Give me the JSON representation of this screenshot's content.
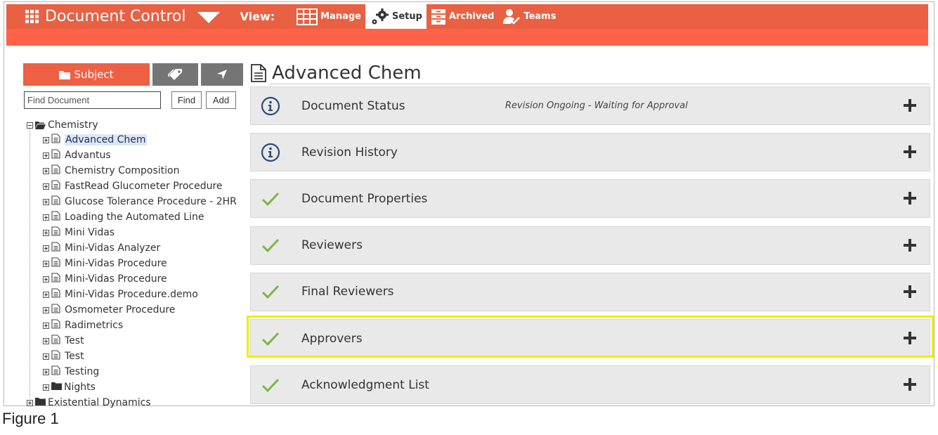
{
  "header": {
    "app_title": "Document Control",
    "view_label": "View:",
    "views": [
      {
        "label": "Manage"
      },
      {
        "label": "Setup"
      },
      {
        "label": "Archived"
      },
      {
        "label": "Teams"
      }
    ]
  },
  "sidebar": {
    "tab_subject": "Subject",
    "search_placeholder": "Find Document",
    "find_label": "Find",
    "add_label": "Add",
    "tree": {
      "root": "Chemistry",
      "items": [
        "Advanced Chem",
        "Advantus",
        "Chemistry Composition",
        "FastRead Glucometer Procedure",
        "Glucose Tolerance Procedure - 2HR",
        "Loading the Automated Line",
        "Mini Vidas",
        "Mini-Vidas Analyzer",
        "Mini-Vidas Procedure",
        "Mini-Vidas Procedure",
        "Mini-Vidas Procedure.demo",
        "Osmometer Procedure",
        "Radimetrics",
        "Test",
        "Test",
        "Testing"
      ],
      "subfolder": "Nights",
      "next_root": "Existential Dynamics"
    }
  },
  "main": {
    "title": "Advanced Chem",
    "panels": [
      {
        "label": "Document Status",
        "status": "Revision Ongoing - Waiting for Approval",
        "icon": "info-icon"
      },
      {
        "label": "Revision History",
        "status": "",
        "icon": "info-icon"
      },
      {
        "label": "Document Properties",
        "status": "",
        "icon": "check-icon"
      },
      {
        "label": "Reviewers",
        "status": "",
        "icon": "check-icon"
      },
      {
        "label": "Final Reviewers",
        "status": "",
        "icon": "check-icon"
      },
      {
        "label": "Approvers",
        "status": "",
        "icon": "check-icon"
      },
      {
        "label": "Acknowledgment List",
        "status": "",
        "icon": "check-icon"
      }
    ]
  },
  "caption": "Figure 1",
  "colors": {
    "accent": "#e96042",
    "check": "#7ab648",
    "info": "#2b4a7a",
    "highlight": "#f4ec00",
    "panel": "#e9e9e9"
  }
}
